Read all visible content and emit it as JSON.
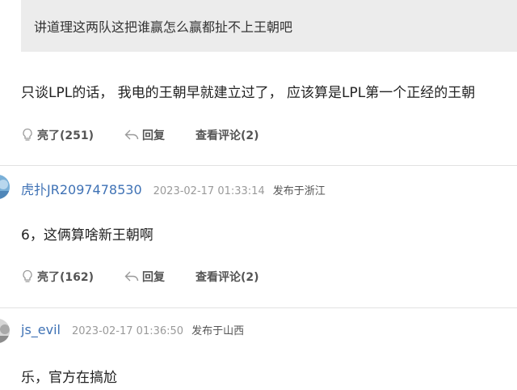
{
  "quote": {
    "text": "讲道理这两队这把谁赢怎么赢都扯不上王朝吧"
  },
  "comments": [
    {
      "content": "只谈LPL的话， 我电的王朝早就建立过了， 应该算是LPL第一个正经的王朝",
      "actions": {
        "like_label": "亮了(251)",
        "reply_label": "回复",
        "view_label": "查看评论(2)"
      }
    },
    {
      "username": "虎扑JR2097478530",
      "time": "2023-02-17 01:33:14",
      "location": "发布于浙江",
      "content": "6，这俩算啥新王朝啊",
      "actions": {
        "like_label": "亮了(162)",
        "reply_label": "回复",
        "view_label": "查看评论(2)"
      }
    },
    {
      "username": "js_evil",
      "time": "2023-02-17 01:36:50",
      "location": "发布于山西",
      "content": "乐，官方在搞尬"
    }
  ],
  "colors": {
    "username": "#3f72b5",
    "timestamp": "#9a9a9a",
    "quote_background": "#ececec",
    "avatar_1": "#7ab0d8",
    "avatar_2": "#c8c8c8"
  },
  "icons": {
    "like": "lightbulb-icon",
    "reply": "reply-arrow-icon",
    "view": "none"
  }
}
